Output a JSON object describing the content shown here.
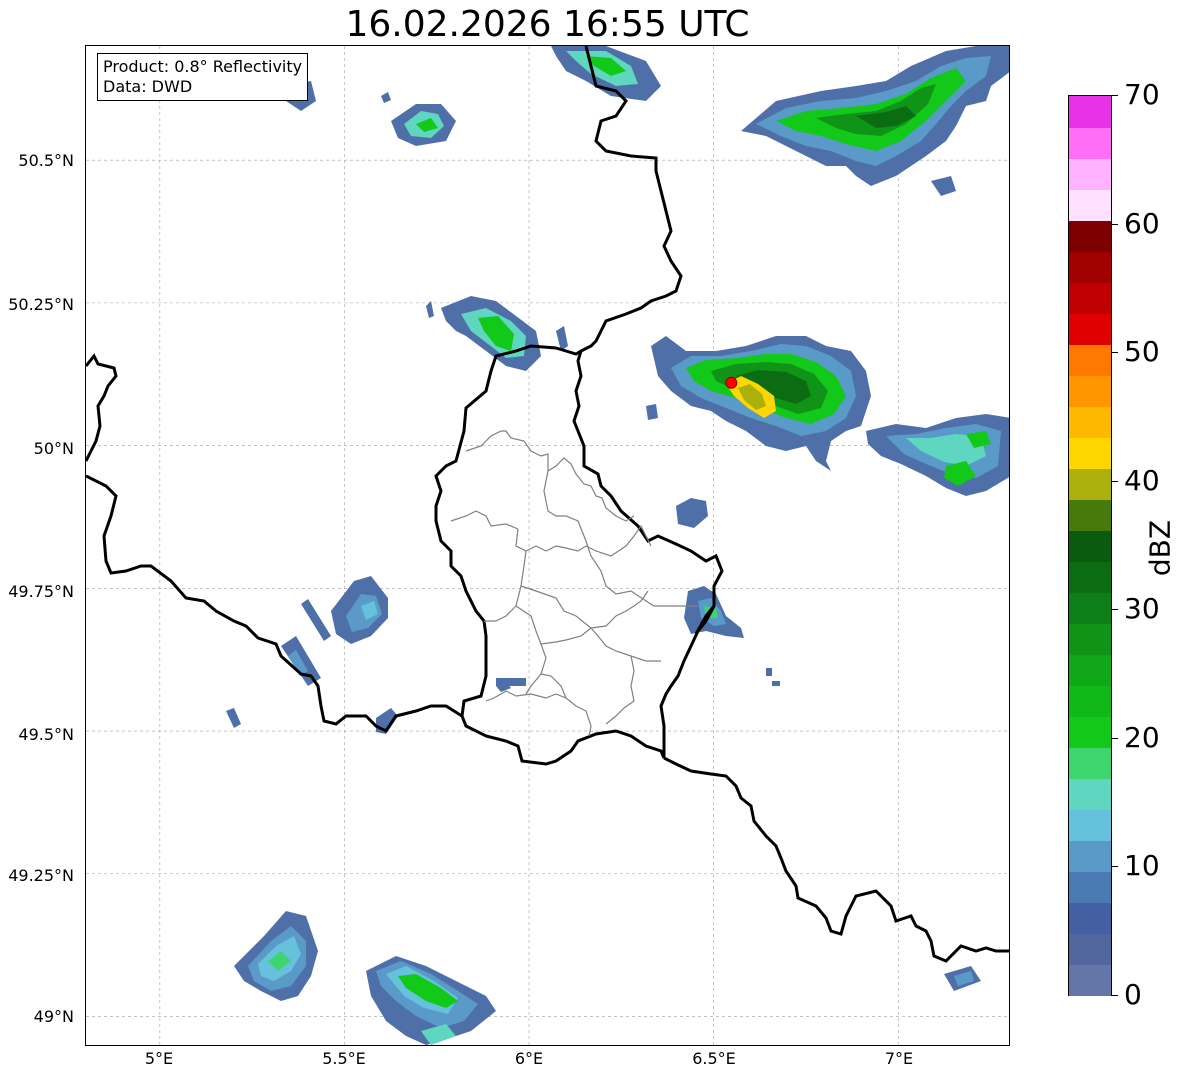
{
  "title": "16.02.2026 16:55 UTC",
  "info_box": {
    "product": "Product: 0.8° Reflectivity",
    "data": "Data: DWD"
  },
  "map": {
    "lat_labels": [
      "50.5°N",
      "50.25°N",
      "50°N",
      "49.75°N",
      "49.5°N",
      "49.25°N",
      "49°N"
    ],
    "lon_labels": [
      "5°E",
      "5.5°E",
      "6°E",
      "6.5°E",
      "7°E"
    ],
    "lat_values": [
      50.5,
      50.25,
      50.0,
      49.75,
      49.5,
      49.25,
      49.0
    ],
    "lon_values": [
      5.0,
      5.5,
      6.0,
      6.5,
      7.0
    ],
    "extent": {
      "lon_min": 4.8,
      "lon_max": 7.3,
      "lat_min": 48.95,
      "lat_max": 50.7
    },
    "radar_site": {
      "lon": 6.548,
      "lat": 50.11,
      "color": "#ff0000"
    },
    "gridlines": true
  },
  "colorbar": {
    "label": "dBZ",
    "ticks": [
      "0",
      "10",
      "20",
      "30",
      "40",
      "50",
      "60",
      "70"
    ],
    "min": 0,
    "max": 70,
    "colors": [
      "#6476a8",
      "#50669c",
      "#4360a2",
      "#4a7ab2",
      "#5a9ac8",
      "#66c2dc",
      "#5fd6c0",
      "#3ed46e",
      "#12c818",
      "#10b818",
      "#10a818",
      "#0f9418",
      "#0e7e16",
      "#0c6c12",
      "#0a5a10",
      "#467a0a",
      "#acb00a",
      "#ffd600",
      "#ffb800",
      "#ff9600",
      "#ff7800",
      "#e00000",
      "#c00000",
      "#a00000",
      "#7e0000",
      "#ffe0ff",
      "#ffb2ff",
      "#ff6ef6",
      "#e832e8"
    ]
  }
}
